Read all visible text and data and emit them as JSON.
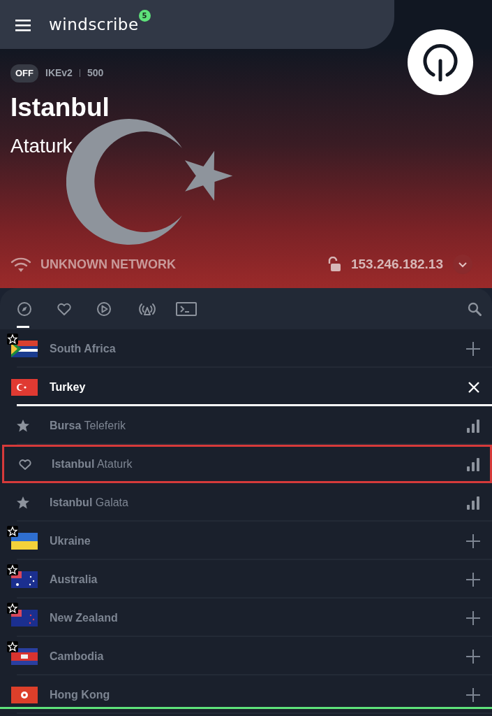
{
  "header": {
    "app_name": "windscribe",
    "badge": "5"
  },
  "status": {
    "state": "OFF",
    "connected": false,
    "protocol": "IKEv2",
    "port": "500"
  },
  "location": {
    "city": "Istanbul",
    "nickname": "Ataturk"
  },
  "network": {
    "name": "UNKNOWN NETWORK",
    "ip": "153.246.182.13"
  },
  "tabs": [
    {
      "kind": "explore",
      "selected": true
    },
    {
      "kind": "favorites",
      "selected": false
    },
    {
      "kind": "streaming",
      "selected": false
    },
    {
      "kind": "static",
      "selected": false
    },
    {
      "kind": "config",
      "selected": false
    }
  ],
  "locations": [
    {
      "name": "South Africa",
      "premium": true,
      "expanded": false
    },
    {
      "name": "Turkey",
      "premium": false,
      "expanded": true,
      "children": [
        {
          "city": "Bursa",
          "nickname": "Teleferik",
          "selected": false
        },
        {
          "city": "Istanbul",
          "nickname": "Ataturk",
          "selected": true
        },
        {
          "city": "Istanbul",
          "nickname": "Galata",
          "selected": false
        }
      ]
    },
    {
      "name": "Ukraine",
      "premium": true,
      "expanded": false
    },
    {
      "name": "Australia",
      "premium": true,
      "expanded": false
    },
    {
      "name": "New Zealand",
      "premium": true,
      "expanded": false
    },
    {
      "name": "Cambodia",
      "premium": true,
      "expanded": false
    },
    {
      "name": "Hong Kong",
      "premium": false,
      "expanded": false
    }
  ]
}
